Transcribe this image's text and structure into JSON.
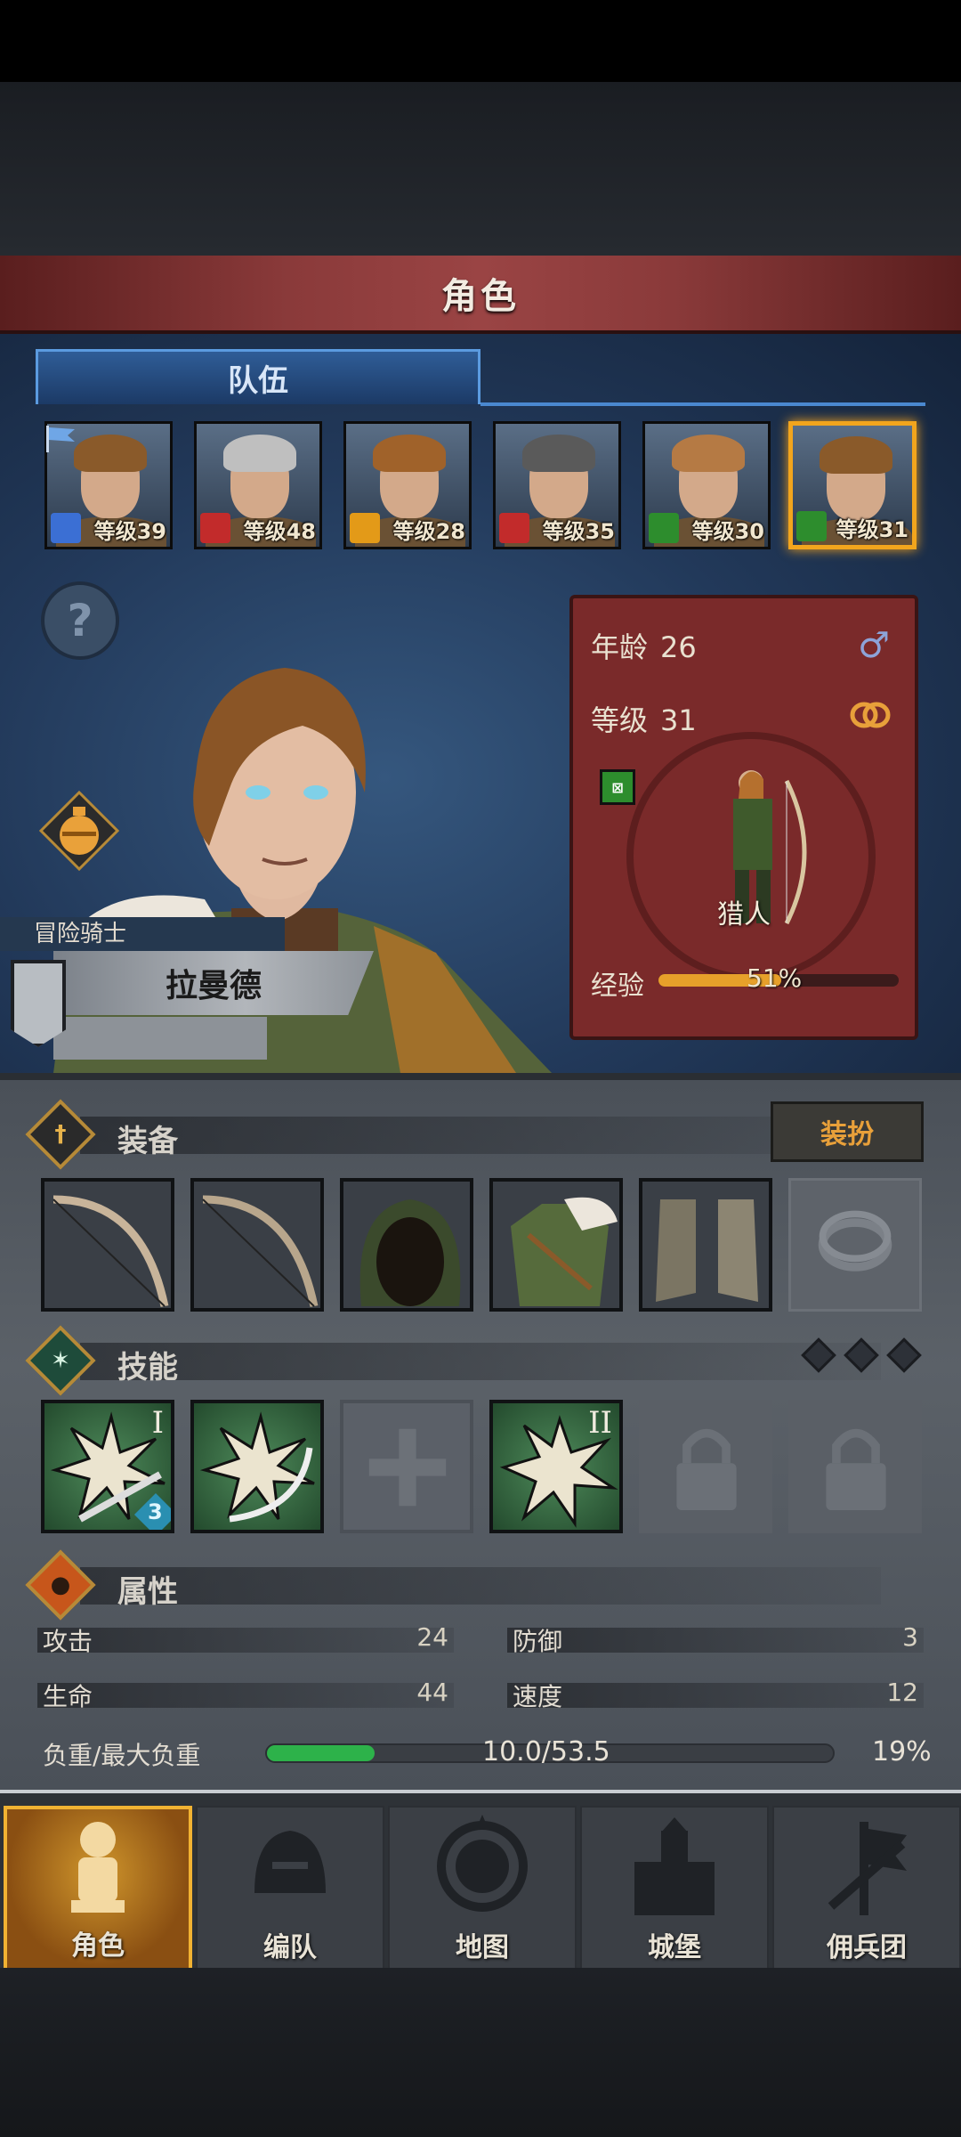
{
  "header": {
    "title": "角色"
  },
  "team": {
    "tab_label": "队伍",
    "members": [
      {
        "level": "等级39",
        "class_icon": "sword-icon",
        "class_color": "#3b6fd4",
        "hair": "#8a5a2a",
        "selected": false
      },
      {
        "level": "等级48",
        "class_icon": "wolf-icon",
        "class_color": "#c22b2b",
        "hair": "#bfbfbf",
        "selected": false
      },
      {
        "level": "等级28",
        "class_icon": "shield-icon",
        "class_color": "#e39a18",
        "hair": "#a0622a",
        "selected": false
      },
      {
        "level": "等级35",
        "class_icon": "wolf-icon",
        "class_color": "#c22b2b",
        "hair": "#5a5a5a",
        "selected": false
      },
      {
        "level": "等级30",
        "class_icon": "bow-icon",
        "class_color": "#2d8d2d",
        "hair": "#b57a44",
        "selected": false
      },
      {
        "level": "等级31",
        "class_icon": "bow-icon",
        "class_color": "#2d8d2d",
        "hair": "#8a5a2a",
        "selected": true
      }
    ]
  },
  "character": {
    "tier": "冒险骑士",
    "name": "拉曼德",
    "age_label": "年龄",
    "age": "26",
    "level_label": "等级",
    "level": "31",
    "class_name": "猎人",
    "xp_label": "经验",
    "xp_percent": 51,
    "xp_text": "51%",
    "gender_symbol": "♂"
  },
  "equipment": {
    "title": "装备",
    "dress_button": "装扮",
    "slots": [
      "bow-icon",
      "bow-icon",
      "hood-icon",
      "armor-icon",
      "boots-icon",
      "ring-icon"
    ]
  },
  "skills": {
    "title": "技能",
    "slots": [
      {
        "icon": "sword-burst-icon",
        "rank": "I",
        "badge": "3",
        "state": "equipped"
      },
      {
        "icon": "bow-burst-icon",
        "rank": "",
        "badge": "",
        "state": "equipped"
      },
      {
        "icon": "cross-icon",
        "rank": "",
        "badge": "",
        "state": "empty"
      },
      {
        "icon": "burst-icon",
        "rank": "II",
        "badge": "",
        "state": "equipped"
      },
      {
        "icon": "lock-icon",
        "rank": "",
        "badge": "",
        "state": "locked"
      },
      {
        "icon": "lock-icon",
        "rank": "",
        "badge": "",
        "state": "locked"
      }
    ]
  },
  "attributes": {
    "title": "属性",
    "attack_label": "攻击",
    "attack": "24",
    "defense_label": "防御",
    "defense": "3",
    "hp_label": "生命",
    "hp": "44",
    "speed_label": "速度",
    "speed": "12",
    "weight_label": "负重/最大负重",
    "weight_value": "10.0/53.5",
    "weight_percent_text": "19%",
    "weight_percent": 19
  },
  "nav": {
    "items": [
      {
        "label": "角色",
        "icon": "knight-icon",
        "active": true
      },
      {
        "label": "编队",
        "icon": "helmet-icon",
        "active": false
      },
      {
        "label": "地图",
        "icon": "compass-icon",
        "active": false
      },
      {
        "label": "城堡",
        "icon": "castle-icon",
        "active": false
      },
      {
        "label": "佣兵团",
        "icon": "banner-icon",
        "active": false
      }
    ]
  },
  "colors": {
    "accent_gold": "#f2a51d",
    "title_red": "#8a3a3a",
    "tab_blue": "#2f5d97",
    "xp_orange": "#e7a02a",
    "weight_green": "#2db24a"
  }
}
